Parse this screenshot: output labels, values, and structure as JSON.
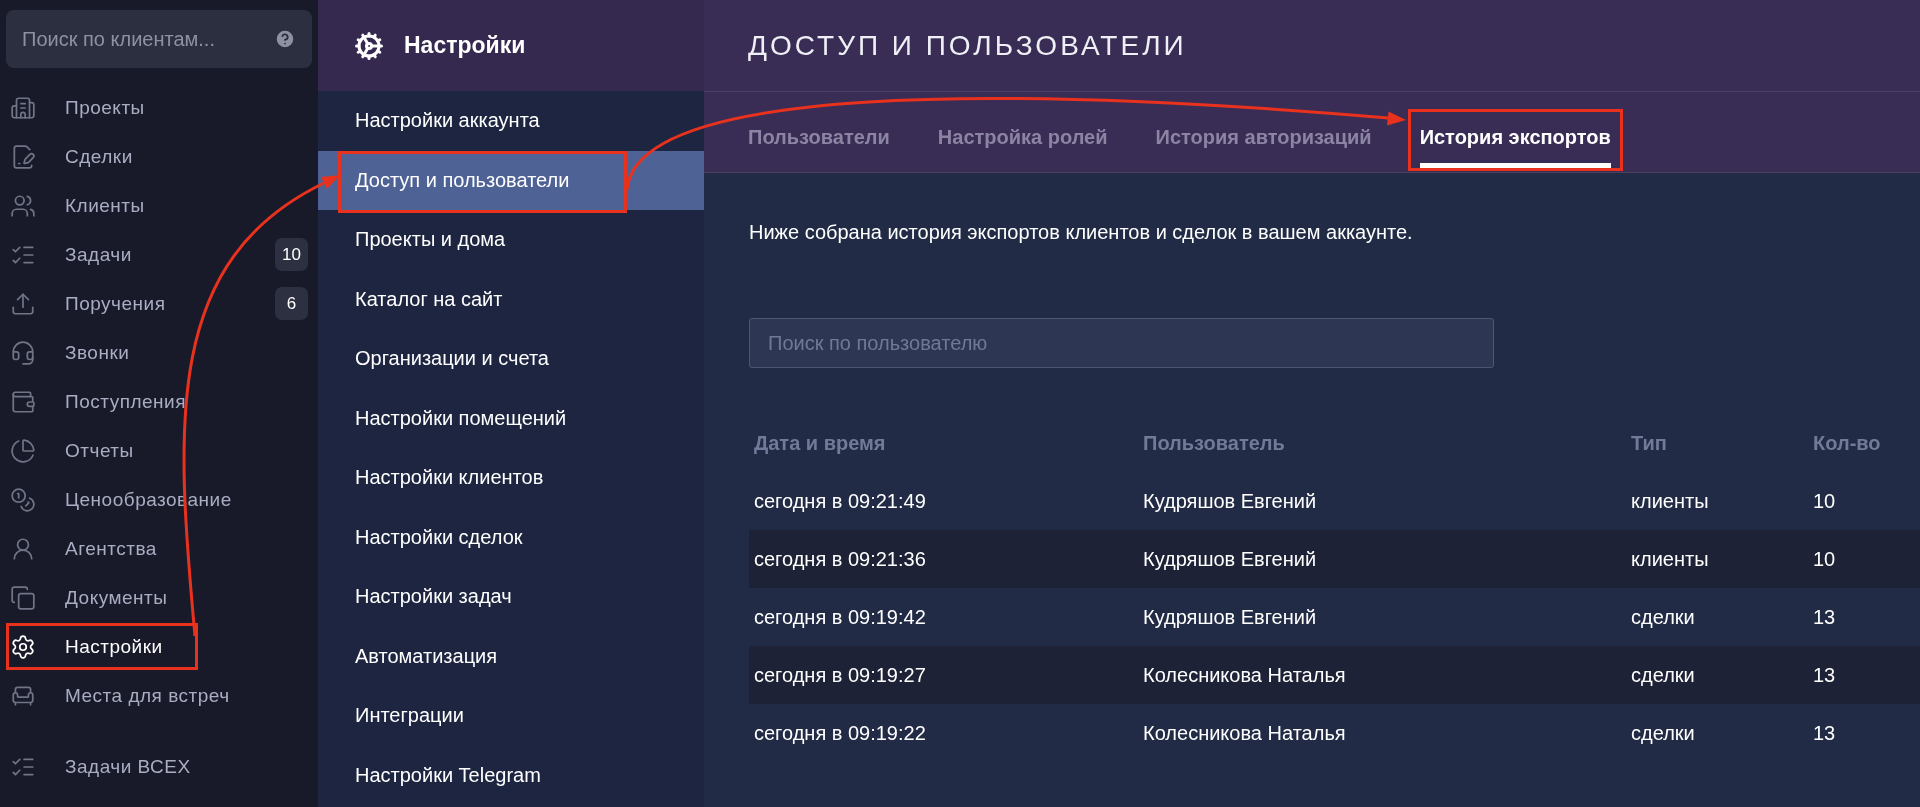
{
  "sidebar": {
    "search": {
      "placeholder": "Поиск по клиентам..."
    },
    "items": [
      {
        "label": "Проекты",
        "selected": false,
        "annotated": false
      },
      {
        "label": "Сделки",
        "selected": false,
        "annotated": false
      },
      {
        "label": "Клиенты",
        "selected": false,
        "annotated": false
      },
      {
        "label": "Задачи",
        "badge": "10",
        "selected": false,
        "annotated": false
      },
      {
        "label": "Поручения",
        "badge": "6",
        "selected": false,
        "annotated": false
      },
      {
        "label": "Звонки",
        "selected": false,
        "annotated": false
      },
      {
        "label": "Поступления",
        "selected": false,
        "annotated": false
      },
      {
        "label": "Отчеты",
        "selected": false,
        "annotated": false
      },
      {
        "label": "Ценообразование",
        "selected": false,
        "annotated": false
      },
      {
        "label": "Агентства",
        "selected": false,
        "annotated": false
      },
      {
        "label": "Документы",
        "selected": false,
        "annotated": false
      },
      {
        "label": "Настройки",
        "selected": true,
        "annotated": true
      },
      {
        "label": "Места для встреч",
        "selected": false,
        "annotated": false
      },
      {
        "label": "Задачи ВСЕХ",
        "selected": false,
        "annotated": false
      }
    ]
  },
  "settings_menu": {
    "title": "Настройки",
    "items": [
      {
        "label": "Настройки аккаунта",
        "selected": false,
        "annotated": false
      },
      {
        "label": "Доступ и пользователи",
        "selected": true,
        "annotated": true
      },
      {
        "label": "Проекты и дома",
        "selected": false,
        "annotated": false
      },
      {
        "label": "Каталог на сайт",
        "selected": false,
        "annotated": false
      },
      {
        "label": "Организации и счета",
        "selected": false,
        "annotated": false
      },
      {
        "label": "Настройки помещений",
        "selected": false,
        "annotated": false
      },
      {
        "label": "Настройки клиентов",
        "selected": false,
        "annotated": false
      },
      {
        "label": "Настройки сделок",
        "selected": false,
        "annotated": false
      },
      {
        "label": "Настройки задач",
        "selected": false,
        "annotated": false
      },
      {
        "label": "Автоматизация",
        "selected": false,
        "annotated": false
      },
      {
        "label": "Интеграции",
        "selected": false,
        "annotated": false
      },
      {
        "label": "Настройки Telegram",
        "selected": false,
        "annotated": false
      }
    ]
  },
  "main": {
    "title": "ДОСТУП И ПОЛЬЗОВАТЕЛИ",
    "tabs": [
      {
        "label": "Пользователи",
        "selected": false,
        "annotated": false
      },
      {
        "label": "Настройка ролей",
        "selected": false,
        "annotated": false
      },
      {
        "label": "История авторизаций",
        "selected": false,
        "annotated": false
      },
      {
        "label": "История экспортов",
        "selected": true,
        "annotated": true
      }
    ],
    "description": "Ниже собрана история экспортов клиентов и сделок в вашем аккаунте.",
    "search": {
      "placeholder": "Поиск по пользователю"
    },
    "table": {
      "columns": [
        "Дата и время",
        "Пользователь",
        "Тип",
        "Кол-во"
      ],
      "rows": [
        [
          "сегодня в 09:21:49",
          "Кудряшов Евгений",
          "клиенты",
          "10"
        ],
        [
          "сегодня в 09:21:36",
          "Кудряшов Евгений",
          "клиенты",
          "10"
        ],
        [
          "сегодня в 09:19:42",
          "Кудряшов Евгений",
          "сделки",
          "13"
        ],
        [
          "сегодня в 09:19:27",
          "Колесникова Наталья",
          "сделки",
          "13"
        ],
        [
          "сегодня в 09:19:22",
          "Колесникова Наталья",
          "сделки",
          "13"
        ]
      ]
    }
  }
}
